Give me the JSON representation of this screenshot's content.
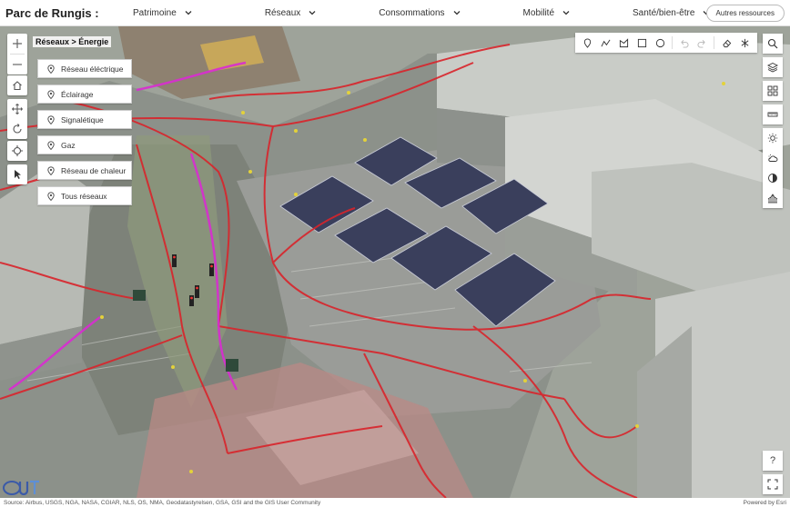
{
  "header": {
    "title": "Parc de Rungis :",
    "nav": [
      {
        "label": "Patrimoine"
      },
      {
        "label": "Réseaux"
      },
      {
        "label": "Consommations"
      },
      {
        "label": "Mobilité"
      },
      {
        "label": "Santé/bien-être"
      }
    ],
    "other_resources": "Autres ressources"
  },
  "map": {
    "breadcrumb": "Réseaux > Énergie",
    "layers": [
      {
        "label": "Réseau éléctrique"
      },
      {
        "label": "Éclairage"
      },
      {
        "label": "Signalétique"
      },
      {
        "label": "Gaz"
      },
      {
        "label": "Réseau de chaleur"
      },
      {
        "label": "Tous réseaux"
      }
    ],
    "help_label": "?",
    "colors": {
      "network_red": "#d9242b",
      "network_magenta": "#d92bd1",
      "solar_panel": "#3a3f5c",
      "ground": "#9ea39a"
    }
  },
  "footer": {
    "attribution": "Source: Airbus, USGS, NGA, NASA, CGIAR, NLS, OS, NMA, Geodatastyrelsen, GSA, GSI and the GIS User Community",
    "powered_by": "Powered by Esri"
  }
}
